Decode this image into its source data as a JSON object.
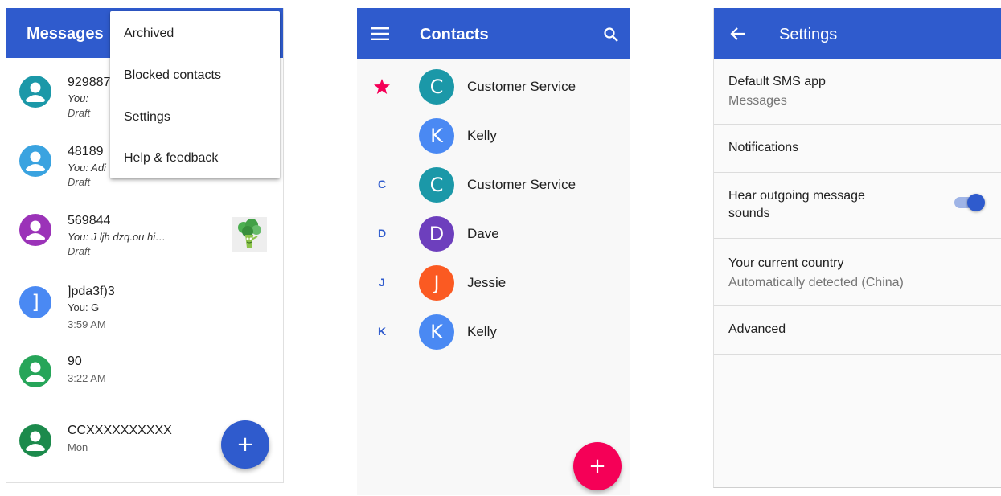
{
  "colors": {
    "primary": "#2f5bcd",
    "accent_pink": "#f50057",
    "teal": "#1b98a8",
    "blue": "#3aa3e0",
    "purple": "#9b33b8",
    "material_blue": "#4a89f3",
    "green": "#26a559",
    "dark_green": "#1c8a4c",
    "deep_purple": "#6d3fbd",
    "orange": "#fb5a22"
  },
  "messages": {
    "title": "Messages",
    "overflow_menu": [
      "Archived",
      "Blocked contacts",
      "Settings",
      "Help & feedback"
    ],
    "conversations": [
      {
        "name": "929887",
        "snippet": "You:",
        "meta": "Draft",
        "avatar": "person-icon"
      },
      {
        "name": "48189",
        "snippet": "You: Adi",
        "meta": "Draft",
        "avatar": "person-icon"
      },
      {
        "name": "569844",
        "snippet": "You: J ljh dzq.ou hi…",
        "meta": "Draft",
        "avatar": "person-icon",
        "thumbnail": "broccoli-sticker-icon"
      },
      {
        "name": "]pda3f)3",
        "snippet": "You: G",
        "meta": "3:59 AM",
        "avatar_letter": "]"
      },
      {
        "name": "90",
        "meta": "3:22 AM",
        "avatar": "person-icon"
      },
      {
        "name": "CCXXXXXXXXXX",
        "meta": "Mon",
        "avatar": "person-icon"
      }
    ],
    "fab_icon": "plus-icon"
  },
  "contacts": {
    "title": "Contacts",
    "menu_icon": "hamburger-icon",
    "search_icon": "search-icon",
    "starred_icon": "star-icon",
    "rows": [
      {
        "section": "",
        "letter": "C",
        "name": "Customer Service"
      },
      {
        "section": "",
        "letter": "K",
        "name": "Kelly"
      },
      {
        "section": "C",
        "letter": "C",
        "name": "Customer Service"
      },
      {
        "section": "D",
        "letter": "D",
        "name": "Dave"
      },
      {
        "section": "J",
        "letter": "J",
        "name": "Jessie"
      },
      {
        "section": "K",
        "letter": "K",
        "name": "Kelly"
      }
    ],
    "fab_icon": "plus-icon"
  },
  "settings": {
    "title": "Settings",
    "back_icon": "arrow-back-icon",
    "items": [
      {
        "title": "Default SMS app",
        "subtitle": "Messages"
      },
      {
        "title": "Notifications"
      },
      {
        "title": "Hear outgoing message",
        "title_line2": "sounds",
        "toggle_on": true
      },
      {
        "title": "Your current country",
        "subtitle": "Automatically detected (China)"
      },
      {
        "title": "Advanced"
      }
    ]
  }
}
